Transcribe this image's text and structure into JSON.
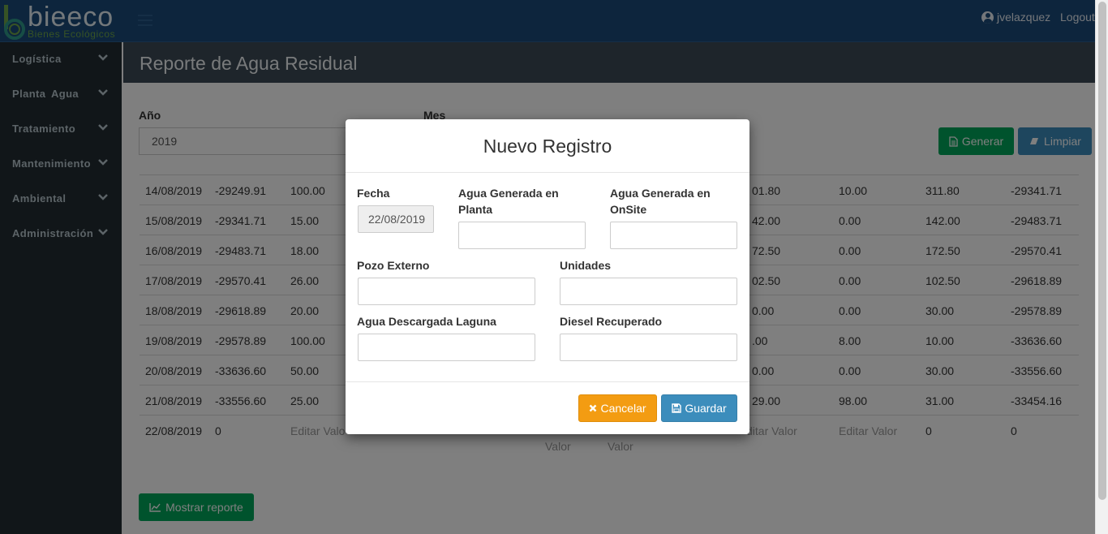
{
  "brand": {
    "name": "bieeco",
    "tagline": "Bienes Ecológicos"
  },
  "header": {
    "user": "jvelazquez",
    "logout": "Logout"
  },
  "sidebar": {
    "items": [
      {
        "label": "Logística"
      },
      {
        "label": "Planta Agua"
      },
      {
        "label": "Tratamiento"
      },
      {
        "label": "Mantenimiento"
      },
      {
        "label": "Ambiental"
      },
      {
        "label": "Administración"
      }
    ]
  },
  "page": {
    "title": "Reporte de Agua Residual",
    "filters": {
      "year_label": "Año",
      "year_value": "2019",
      "month_label": "Mes"
    },
    "buttons": {
      "generate": "Generar",
      "clear": "Limpiar",
      "show_report": "Mostrar reporte"
    }
  },
  "table": {
    "rows": [
      {
        "c1": "14/08/2019",
        "c2": "-29249.91",
        "c3": "100.00",
        "c4": "01.80",
        "c5": "10.00",
        "c6": "311.80",
        "c7": "-29341.71"
      },
      {
        "c1": "15/08/2019",
        "c2": "-29341.71",
        "c3": "15.00",
        "c4": "42.00",
        "c5": "0.00",
        "c6": "142.00",
        "c7": "-29483.71"
      },
      {
        "c1": "16/08/2019",
        "c2": "-29483.71",
        "c3": "18.00",
        "c4": "72.50",
        "c5": "0.00",
        "c6": "172.50",
        "c7": "-29570.41"
      },
      {
        "c1": "17/08/2019",
        "c2": "-29570.41",
        "c3": "26.00",
        "c4": "02.50",
        "c5": "0.00",
        "c6": "102.50",
        "c7": "-29618.89"
      },
      {
        "c1": "18/08/2019",
        "c2": "-29618.89",
        "c3": "20.00",
        "c4": "0.00",
        "c5": "0.00",
        "c6": "30.00",
        "c7": "-29578.89"
      },
      {
        "c1": "19/08/2019",
        "c2": "-29578.89",
        "c3": "100.00",
        "c4": ".00",
        "c5": "8.00",
        "c6": "10.00",
        "c7": "-33636.60"
      },
      {
        "c1": "20/08/2019",
        "c2": "-33636.60",
        "c3": "50.00",
        "c4": "0.00",
        "c5": "0.00",
        "c6": "30.00",
        "c7": "-33556.60"
      },
      {
        "c1": "21/08/2019",
        "c2": "-33556.60",
        "c3": "25.00",
        "c4": "29.00",
        "c5": "98.00",
        "c6": "31.00",
        "c7": "-33454.16"
      }
    ],
    "last_row": {
      "c1": "22/08/2019",
      "c2": "0",
      "c3": "Editar Valo",
      "c4": "ditar Valor",
      "c5": "Editar Valor",
      "c6": "0",
      "c7": "0",
      "below1": "Valor",
      "below2": "Valor"
    }
  },
  "modal": {
    "title": "Nuevo Registro",
    "fecha_label": "Fecha",
    "fecha_value": "22/08/2019",
    "agua_planta_label": "Agua Generada en Planta",
    "agua_onsite_label": "Agua Generada en OnSite",
    "pozo_label": "Pozo Externo",
    "unidades_label": "Unidades",
    "laguna_label": "Agua Descargada Laguna",
    "diesel_label": "Diesel Recuperado",
    "cancel": "Cancelar",
    "save": "Guardar"
  },
  "colors": {
    "header": "#1a4a7a",
    "sidebar": "#222d32",
    "success": "#00a65a",
    "primary": "#3c8dbc",
    "warning": "#f39c12"
  }
}
